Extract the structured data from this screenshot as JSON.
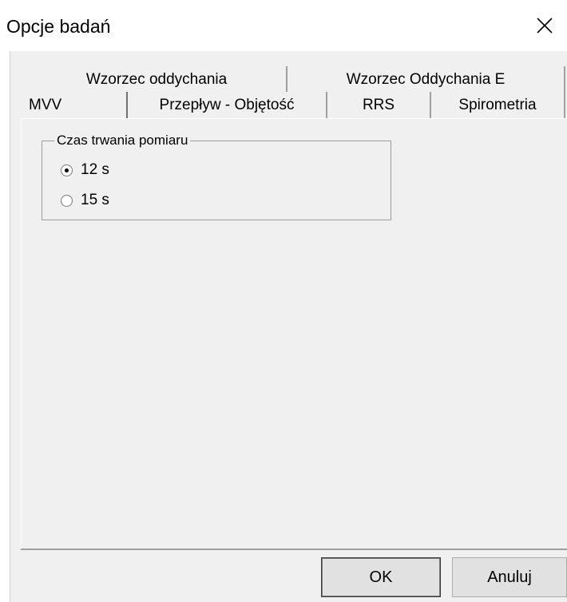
{
  "window": {
    "title": "Opcje badań",
    "close_icon": "close-icon"
  },
  "tabs_back": [
    {
      "label": "Wzorzec oddychania"
    },
    {
      "label": "Wzorzec Oddychania E"
    }
  ],
  "tabs_front": [
    {
      "label": "MVV",
      "active": true
    },
    {
      "label": "Przepływ - Objętość",
      "active": false
    },
    {
      "label": "RRS",
      "active": false
    },
    {
      "label": "Spirometria",
      "active": false
    }
  ],
  "measurement_group": {
    "legend": "Czas trwania pomiaru",
    "options": [
      {
        "label": "12 s",
        "checked": true
      },
      {
        "label": "15 s",
        "checked": false
      }
    ]
  },
  "buttons": {
    "ok": "OK",
    "cancel": "Anuluj"
  },
  "colors": {
    "dialog_bg": "#f0f0f0",
    "title_bg": "#ffffff",
    "border": "#a0a0a0"
  }
}
